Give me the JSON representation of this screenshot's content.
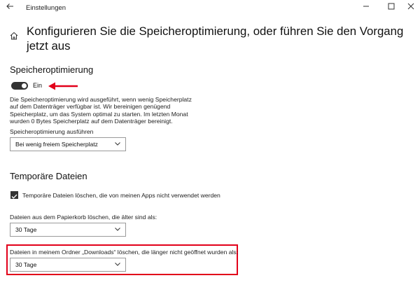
{
  "window": {
    "title": "Einstellungen",
    "back_icon": "back-arrow-icon",
    "minimize_icon": "minimize-icon",
    "maximize_icon": "maximize-icon",
    "close_icon": "close-icon"
  },
  "page": {
    "title": "Konfigurieren Sie die Speicheroptimierung, oder führen Sie den Vorgang jetzt aus",
    "home_icon": "home-icon"
  },
  "storage_sense": {
    "heading": "Speicheroptimierung",
    "toggle_state": true,
    "toggle_label": "Ein",
    "description": "Die Speicheroptimierung wird ausgeführt, wenn wenig Speicherplatz auf dem Datenträger verfügbar ist. Wir bereinigen genügend Speicherplatz, um das System optimal zu starten. Im letzten Monat wurden 0 Bytes Speicherplatz auf dem Datenträger bereinigt.",
    "run_label": "Speicheroptimierung ausführen",
    "run_value": "Bei wenig freiem Speicherplatz"
  },
  "temp_files": {
    "heading": "Temporäre Dateien",
    "delete_unused_checked": true,
    "delete_unused_label": "Temporäre Dateien löschen, die von meinen Apps nicht verwendet werden",
    "recycle_label": "Dateien aus dem Papierkorb löschen, die älter sind als:",
    "recycle_value": "30 Tage",
    "downloads_label": "Dateien in meinem Ordner „Downloads“ löschen, die länger nicht geöffnet wurden als:",
    "downloads_value": "30 Tage"
  },
  "colors": {
    "annotation_red": "#e2001a",
    "toggle_on": "#333333"
  }
}
